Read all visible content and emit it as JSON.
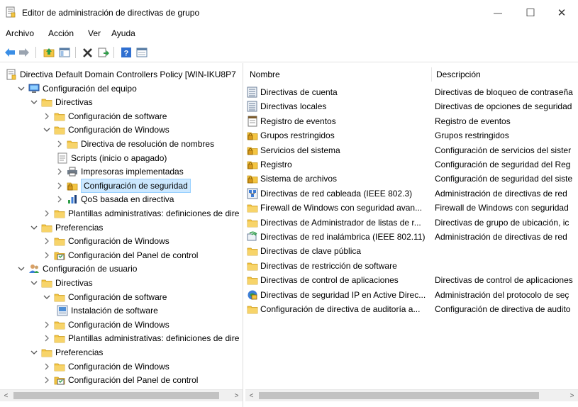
{
  "window": {
    "title": "Editor de administración de directivas de grupo",
    "minimize_glyph": "—",
    "maximize_glyph": "☐",
    "close_glyph": "✕"
  },
  "menu": [
    "Archivo",
    "Acción",
    "Ver",
    "Ayuda"
  ],
  "toolbar": {
    "icons": [
      "back-arrow-icon",
      "forward-arrow-icon",
      "up-folder-icon",
      "show-hide-tree-icon",
      "delete-icon",
      "export-list-icon",
      "help-icon",
      "properties-icon"
    ]
  },
  "tree": {
    "items": [
      {
        "label": "Directiva Default Domain Controllers Policy [WIN-IKU8P7",
        "icon": "policy-icon",
        "expander": ""
      },
      {
        "label": "Configuración del equipo",
        "icon": "computer-icon",
        "expander": "v"
      },
      {
        "label": "Directivas",
        "icon": "folder-icon",
        "expander": "v"
      },
      {
        "label": "Configuración de software",
        "icon": "folder-icon",
        "expander": ">"
      },
      {
        "label": "Configuración de Windows",
        "icon": "folder-icon",
        "expander": "v"
      },
      {
        "label": "Directiva de resolución de nombres",
        "icon": "folder-icon",
        "expander": ">"
      },
      {
        "label": "Scripts (inicio o apagado)",
        "icon": "script-icon",
        "expander": ""
      },
      {
        "label": "Impresoras implementadas",
        "icon": "printer-icon",
        "expander": ">"
      },
      {
        "label": "Configuración de seguridad",
        "icon": "security-icon",
        "expander": ">"
      },
      {
        "label": "QoS basada en directiva",
        "icon": "chart-icon",
        "expander": ">"
      },
      {
        "label": "Plantillas administrativas: definiciones de dire",
        "icon": "folder-icon",
        "expander": ">"
      },
      {
        "label": "Preferencias",
        "icon": "folder-icon",
        "expander": "v"
      },
      {
        "label": "Configuración de Windows",
        "icon": "folder-icon",
        "expander": ">"
      },
      {
        "label": "Configuración del Panel de control",
        "icon": "control-panel-icon",
        "expander": ">"
      },
      {
        "label": "Configuración de usuario",
        "icon": "user-icon",
        "expander": "v"
      },
      {
        "label": "Directivas",
        "icon": "folder-icon",
        "expander": "v"
      },
      {
        "label": "Configuración de software",
        "icon": "folder-icon",
        "expander": "v"
      },
      {
        "label": "Instalación de software",
        "icon": "software-install-icon",
        "expander": ""
      },
      {
        "label": "Configuración de Windows",
        "icon": "folder-icon",
        "expander": ">"
      },
      {
        "label": "Plantillas administrativas: definiciones de dire",
        "icon": "folder-icon",
        "expander": ">"
      },
      {
        "label": "Preferencias",
        "icon": "folder-icon",
        "expander": "v"
      },
      {
        "label": "Configuración de Windows",
        "icon": "folder-icon",
        "expander": ">"
      },
      {
        "label": "Configuración del Panel de control",
        "icon": "control-panel-icon",
        "expander": ">"
      }
    ],
    "selected_index": 8
  },
  "list": {
    "columns": {
      "name": "Nombre",
      "description": "Descripción"
    },
    "rows": [
      {
        "name": "Directivas de cuenta",
        "description": "Directivas de bloqueo de contraseña",
        "icon": "policy-list-icon"
      },
      {
        "name": "Directivas locales",
        "description": "Directivas de opciones de seguridad",
        "icon": "policy-list-icon"
      },
      {
        "name": "Registro de eventos",
        "description": "Registro de eventos",
        "icon": "event-log-icon"
      },
      {
        "name": "Grupos restringidos",
        "description": "Grupos restringidos",
        "icon": "locked-folder-icon"
      },
      {
        "name": "Servicios del sistema",
        "description": "Configuración de servicios del sister",
        "icon": "locked-folder-icon"
      },
      {
        "name": "Registro",
        "description": "Configuración de seguridad del Reg",
        "icon": "locked-folder-icon"
      },
      {
        "name": "Sistema de archivos",
        "description": "Configuración de seguridad del siste",
        "icon": "locked-folder-icon"
      },
      {
        "name": "Directivas de red cableada (IEEE 802.3)",
        "description": "Administración de directivas de red",
        "icon": "wired-network-icon"
      },
      {
        "name": "Firewall de Windows con seguridad avan...",
        "description": "Firewall de Windows con seguridad",
        "icon": "folder-icon"
      },
      {
        "name": "Directivas de Administrador de listas de r...",
        "description": "Directivas de grupo de ubicación, ic",
        "icon": "folder-icon"
      },
      {
        "name": "Directivas de red inalámbrica (IEEE 802.11)",
        "description": "Administración de directivas de red",
        "icon": "wireless-network-icon"
      },
      {
        "name": "Directivas de clave pública",
        "description": "",
        "icon": "folder-icon"
      },
      {
        "name": "Directivas de restricción de software",
        "description": "",
        "icon": "folder-icon"
      },
      {
        "name": "Directivas de control de aplicaciones",
        "description": "Directivas de control de aplicaciones",
        "icon": "folder-icon"
      },
      {
        "name": "Directivas de seguridad IP en Active Direc...",
        "description": "Administración del protocolo de seç",
        "icon": "ip-security-icon"
      },
      {
        "name": "Configuración de directiva de auditoría a...",
        "description": "Configuración de directiva de audito",
        "icon": "folder-icon"
      }
    ]
  },
  "scrollbars": {
    "left_glyph": "<",
    "right_glyph": ">"
  },
  "colors": {
    "selection_bg": "#cce8ff",
    "selection_border": "#99d1ff",
    "folder": "#f4c542",
    "toolbar_arrow": "#3a8ee6"
  }
}
